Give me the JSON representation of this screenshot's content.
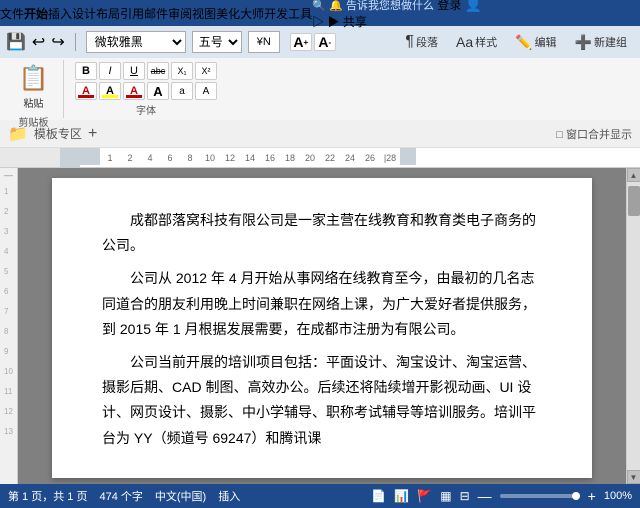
{
  "menubar": {
    "items": [
      "文件",
      "开始",
      "插入",
      "设计",
      "布局",
      "引用",
      "邮件",
      "审阅",
      "视图",
      "美化大师",
      "开发工具"
    ],
    "active": "开始",
    "bell_label": "🔔 告诉我您想做什么",
    "login_label": "登录",
    "share_label": "▶ 共享"
  },
  "toolbar": {
    "font_name": "微软雅黑",
    "font_size": "五号",
    "font_size_pt": "¥N",
    "bold": "B",
    "italic": "I",
    "underline": "U",
    "strikethrough": "abc",
    "subscript": "X₁",
    "superscript": "X²",
    "paste_label": "粘贴",
    "clipboard_label": "剪贴板",
    "font_label": "字体",
    "para_label": "段落",
    "style_label": "样式",
    "edit_label": "编辑",
    "new_group_label": "新建组",
    "aa_large": "A",
    "aa_small": "a",
    "font_color": "A",
    "highlight_color": "A",
    "font_color2": "A",
    "font_size_inc": "A",
    "font_size_dec": "A",
    "char_spacing": "A"
  },
  "pathbar": {
    "folder_icon": "📁",
    "template_text": "模板专区",
    "add_icon": "+",
    "window_merge": "□ 窗口合并显示"
  },
  "ruler": {
    "marks": [
      "1",
      "2",
      "4",
      "6",
      "8",
      "10",
      "12",
      "14",
      "16",
      "18",
      "20",
      "22",
      "24",
      "26",
      "28"
    ]
  },
  "content": {
    "paragraphs": [
      "成都部落窝科技有限公司是一家主营在线教育和教育类电子商务的公司。",
      "公司从 2012 年 4 月开始从事网络在线教育至今，由最初的几名志同道合的朋友利用晚上时间兼职在网络上课，为广大爱好者提供服务，到 2015 年 1 月根据发展需要，在成都市注册为有限公司。",
      "公司当前开展的培训项目包括：平面设计、淘宝设计、淘宝运营、摄影后期、CAD 制图、高效办公。后续还将陆续增开影视动画、UI 设计、网页设计、摄影、中小学辅导、职称考试辅导等培训服务。培训平台为 YY（频道号 69247）和腾讯课"
    ]
  },
  "statusbar": {
    "page_info": "第 1 页，共 1 页",
    "word_count": "474 个字",
    "language": "中文(中国)",
    "insert_mode": "插入",
    "icons": "📄 📊",
    "zoom": "100%",
    "zoom_level": 90
  },
  "line_numbers": [
    "1",
    "2",
    "3",
    "4",
    "5",
    "6",
    "7",
    "8",
    "9",
    "10",
    "11",
    "12",
    "13"
  ]
}
